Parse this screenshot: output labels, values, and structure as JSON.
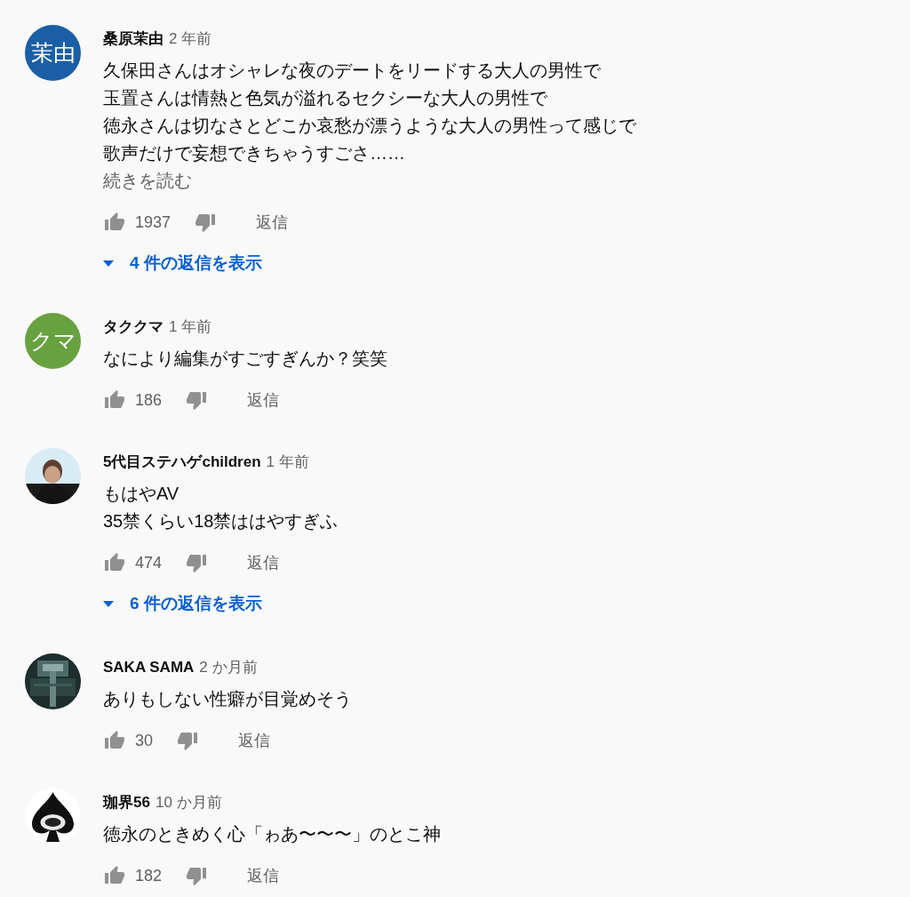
{
  "comments": [
    {
      "avatar": {
        "kind": "letters",
        "text": "茉由",
        "color": "#1a5fa6"
      },
      "author": "桑原茉由",
      "time": "2 年前",
      "body": [
        "久保田さんはオシャレな夜のデートをリードする大人の男性で",
        "玉置さんは情熱と色気が溢れるセクシーな大人の男性で",
        "徳永さんは切なさとどこか哀愁が漂うような大人の男性って感じで",
        "歌声だけで妄想できちゃうすごさ……"
      ],
      "read_more": "続きを読む",
      "likes": "1937",
      "reply": "返信",
      "replies_link": "4 件の返信を表示"
    },
    {
      "avatar": {
        "kind": "letters",
        "text": "クマ",
        "color": "#68a13f"
      },
      "author": "タククマ",
      "time": "1 年前",
      "body": [
        "なにより編集がすごすぎんか？笑笑"
      ],
      "likes": "186",
      "reply": "返信"
    },
    {
      "avatar": {
        "kind": "picture"
      },
      "author": "5代目ステハゲchildren",
      "time": "1 年前",
      "body": [
        "もはやAV",
        "35禁くらい18禁ははやすぎふ"
      ],
      "likes": "474",
      "reply": "返信",
      "replies_link": "6 件の返信を表示"
    },
    {
      "avatar": {
        "kind": "picture"
      },
      "author": "SAKA SAMA",
      "time": "2 か月前",
      "body": [
        "ありもしない性癖が目覚めそう"
      ],
      "likes": "30",
      "reply": "返信"
    },
    {
      "avatar": {
        "kind": "picture"
      },
      "author": "珈界56",
      "time": "10 か月前",
      "body": [
        "徳永のときめく心「ゎあ〜〜〜」のとこ神"
      ],
      "likes": "182",
      "reply": "返信"
    }
  ]
}
